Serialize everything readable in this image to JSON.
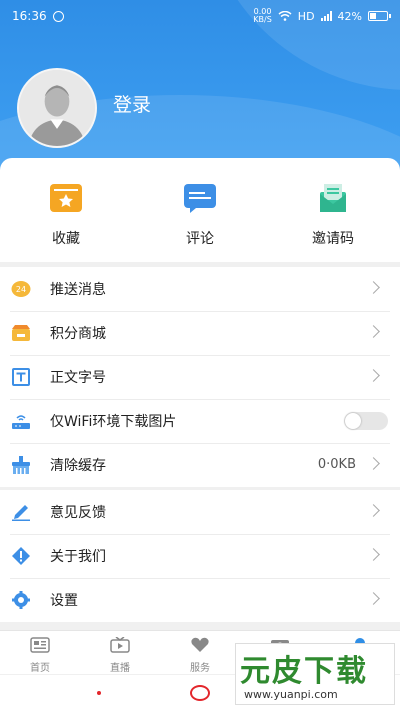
{
  "status_bar": {
    "time": "16:36",
    "net_speed_value": "0.00",
    "net_speed_unit": "KB/S",
    "hd": "HD",
    "battery": "42%"
  },
  "profile": {
    "login_label": "登录"
  },
  "quick_actions": [
    {
      "label": "收藏",
      "icon": "favorite-icon",
      "color": "#f5a623"
    },
    {
      "label": "评论",
      "icon": "comment-icon",
      "color": "#3d8fe6"
    },
    {
      "label": "邀请码",
      "icon": "invite-code-icon",
      "color": "#3cc7a0"
    }
  ],
  "settings_group_1": [
    {
      "label": "推送消息",
      "icon": "push-24-icon"
    },
    {
      "label": "积分商城",
      "icon": "points-store-icon"
    },
    {
      "label": "正文字号",
      "icon": "font-size-icon"
    },
    {
      "label": "仅WiFi环境下载图片",
      "icon": "router-icon",
      "toggle": "off"
    },
    {
      "label": "清除缓存",
      "icon": "clear-cache-icon",
      "value": "0·0KB"
    }
  ],
  "settings_group_2": [
    {
      "label": "意见反馈",
      "icon": "feedback-pen-icon"
    },
    {
      "label": "关于我们",
      "icon": "about-icon"
    },
    {
      "label": "设置",
      "icon": "gear-icon"
    }
  ],
  "tabbar": [
    {
      "label": "首页",
      "icon": "news-icon"
    },
    {
      "label": "直播",
      "icon": "tv-play-icon"
    },
    {
      "label": "服务",
      "icon": "heart-icon"
    },
    {
      "label": "",
      "icon": "camera-icon"
    },
    {
      "label": "",
      "icon": "user-icon"
    }
  ],
  "watermark": {
    "title": "元皮下载",
    "url": "www.yuanpi.com"
  },
  "colors": {
    "header_blue": "#2f8ee6",
    "nav_red": "#e3262b"
  }
}
